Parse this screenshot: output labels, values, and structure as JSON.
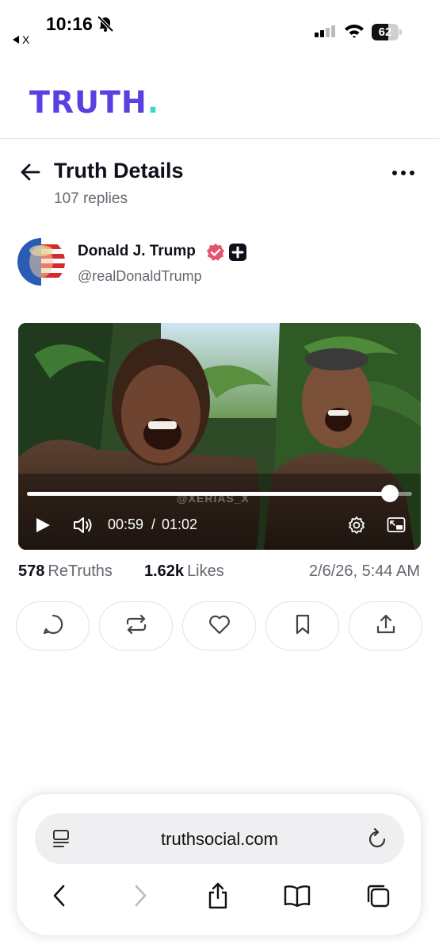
{
  "status_bar": {
    "time": "10:16",
    "back_app_label": "X",
    "battery_level": "62",
    "battery_fraction": 0.62
  },
  "header": {
    "logo_text": "TRUTH",
    "logo_dot": ".",
    "logo_color": "#5b3fe0",
    "logo_accent_color": "#3fd7c7"
  },
  "post_header": {
    "title": "Truth Details",
    "replies": "107 replies"
  },
  "author": {
    "name": "Donald J. Trump",
    "handle": "@realDonaldTrump"
  },
  "video": {
    "watermark": "@XERIAS_X",
    "current_time": "00:59",
    "separator": "/",
    "total_time": "01:02",
    "progress_fraction": 0.943
  },
  "stats": {
    "retruths_count": "578",
    "retruths_label": "ReTruths",
    "likes_count": "1.62k",
    "likes_label": "Likes",
    "date": "2/6/26, 5:44 AM"
  },
  "actions": [
    {
      "icon": "reply-icon"
    },
    {
      "icon": "retruth-icon"
    },
    {
      "icon": "like-icon"
    },
    {
      "icon": "bookmark-icon"
    },
    {
      "icon": "share-icon"
    }
  ],
  "browser": {
    "url": "truthsocial.com"
  }
}
